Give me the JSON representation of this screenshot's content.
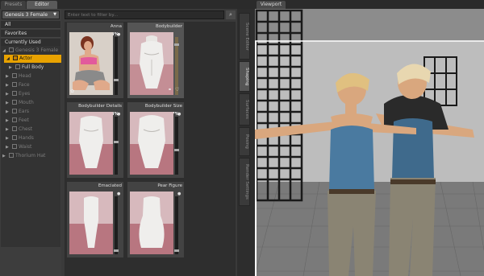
{
  "tabs": {
    "presets": "Presets",
    "editor": "Editor",
    "viewport": "Viewport"
  },
  "left": {
    "figure": "Genesis 3 Female",
    "nav": [
      "All",
      "Favorites",
      "Currently Used"
    ],
    "tree": [
      {
        "label": "Genesis 3 Female",
        "level": 0,
        "dim": true
      },
      {
        "label": "Actor",
        "level": 1,
        "selected": true
      },
      {
        "label": "Full Body",
        "level": 2
      },
      {
        "label": "Head",
        "level": 1,
        "dim": true
      },
      {
        "label": "Face",
        "level": 1,
        "dim": true
      },
      {
        "label": "Eyes",
        "level": 1,
        "dim": true
      },
      {
        "label": "Mouth",
        "level": 1,
        "dim": true
      },
      {
        "label": "Ears",
        "level": 1,
        "dim": true
      },
      {
        "label": "Feet",
        "level": 1,
        "dim": true
      },
      {
        "label": "Chest",
        "level": 1,
        "dim": true
      },
      {
        "label": "Hands",
        "level": 1,
        "dim": true
      },
      {
        "label": "Waist",
        "level": 1,
        "dim": true
      },
      {
        "label": "Thorium Hat",
        "level": 0,
        "dim": true
      }
    ]
  },
  "filter": {
    "placeholder": "Enter text to filter by..."
  },
  "morphs": [
    {
      "name": "Anna",
      "value": "25.8%",
      "level": 0.258
    },
    {
      "name": "Bodybuilder",
      "value": "",
      "level": 0.0
    },
    {
      "name": "Bodybuilder Details",
      "value": "58.8%",
      "level": 0.588
    },
    {
      "name": "Bodybuilder Size",
      "value": "42.7%",
      "level": 0.427
    },
    {
      "name": "Emaciated",
      "value": "",
      "level": 0.0
    },
    {
      "name": "Pear Figure",
      "value": "",
      "level": 0.0
    }
  ],
  "side_tabs": [
    "Scene Editor",
    "Shaping",
    "Surfaces",
    "Posing",
    "Render Settings"
  ],
  "colors": {
    "accent": "#e8a200",
    "morph_bg": "#c9959c"
  }
}
